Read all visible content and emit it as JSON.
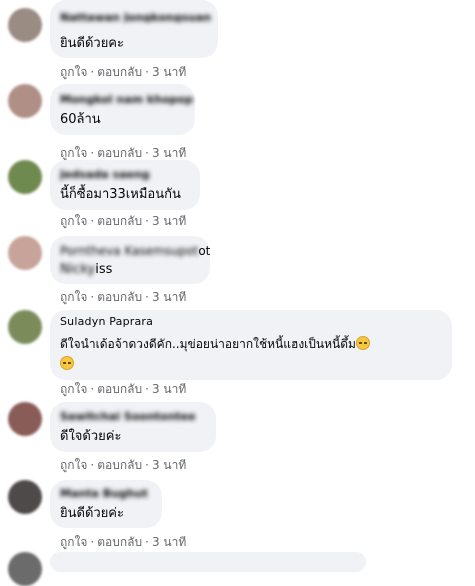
{
  "comments": [
    {
      "author": "Nattawan Jongkongsuan",
      "text": "ยินดีด้วยคะ",
      "like": "ถูกใจ",
      "reply": "ตอบกลับ",
      "time": "3 นาที",
      "avatar_color": "#9a8b83"
    },
    {
      "author": "Mongkol nam khopop",
      "text": "60ล้าน",
      "like": "ถูกใจ",
      "reply": "ตอบกลับ",
      "time": "3 นาที",
      "avatar_color": "#b08f86"
    },
    {
      "author": "Jedsada saeng",
      "text": "นี้ก็ซื้อมา33เหมือนกัน",
      "like": "ถูกใจ",
      "reply": "ตอบกลับ",
      "time": "3 นาที",
      "avatar_color": "#6f8a4f"
    },
    {
      "author_hidden": "Porntheva Kasemsupot",
      "author_visible": "ot",
      "line2_hidden": "Nicky",
      "line2_visible": "iss",
      "like": "ถูกใจ",
      "reply": "ตอบกลับ",
      "time": "3 นาที",
      "avatar_color": "#c7a39a"
    },
    {
      "author": "Suladyn Paprara",
      "text": "ดีใจนำเด้อจ้าดวงดีคัก..มุข่อยน่าอยากใช้หนี้แฮงเป็นหนี้ดึ้ม",
      "like": "ถูกใจ",
      "reply": "ตอบกลับ",
      "time": "3 นาที",
      "avatar_color": "#7b8c5a"
    },
    {
      "author": "Sawitchai Soontontee",
      "text": "ดีใจด้วยค่ะ",
      "like": "ถูกใจ",
      "reply": "ตอบกลับ",
      "time": "3 นาที",
      "avatar_color": "#8a5c58"
    },
    {
      "author": "Manta Bughut",
      "text": "ยินดีด้วยค่ะ",
      "like": "ถูกใจ",
      "reply": "ตอบกลับ",
      "time": "3 นาที",
      "avatar_color": "#4e4a4a"
    }
  ]
}
